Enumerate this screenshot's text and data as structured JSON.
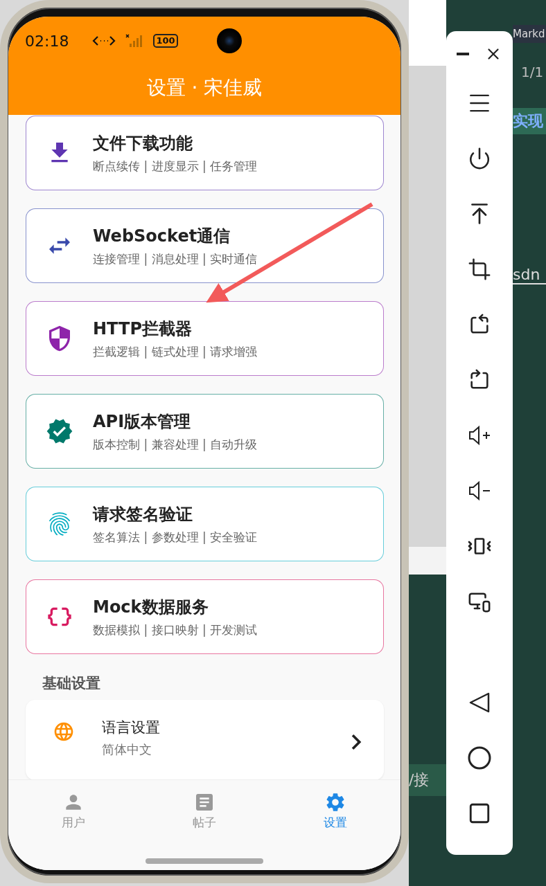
{
  "status_bar": {
    "time": "02:18",
    "battery": "100"
  },
  "header": {
    "title": "设置 · 宋佳威"
  },
  "features": [
    {
      "title": "文件下载功能",
      "subtitle": "断点续传 | 进度显示 | 任务管理",
      "color": "#5e35b1"
    },
    {
      "title": "WebSocket通信",
      "subtitle": "连接管理 | 消息处理 | 实时通信",
      "color": "#3949ab"
    },
    {
      "title": "HTTP拦截器",
      "subtitle": "拦截逻辑 | 链式处理 | 请求增强",
      "color": "#8e24aa"
    },
    {
      "title": "API版本管理",
      "subtitle": "版本控制 | 兼容处理 | 自动升级",
      "color": "#00796b"
    },
    {
      "title": "请求签名验证",
      "subtitle": "签名算法 | 参数处理 | 安全验证",
      "color": "#00acc1"
    },
    {
      "title": "Mock数据服务",
      "subtitle": "数据模拟 | 接口映射 | 开发测试",
      "color": "#d81b60"
    }
  ],
  "section_title": "基础设置",
  "settings": [
    {
      "title": "语言设置",
      "value": "简体中文"
    }
  ],
  "bottom_nav": [
    {
      "label": "用户",
      "selected": false
    },
    {
      "label": "帖子",
      "selected": false
    },
    {
      "label": "设置",
      "selected": true
    }
  ],
  "background_window": {
    "tab_label": "Markd",
    "page_count": "1/1",
    "heading": "实现",
    "link": "sdn",
    "code": "/接"
  }
}
